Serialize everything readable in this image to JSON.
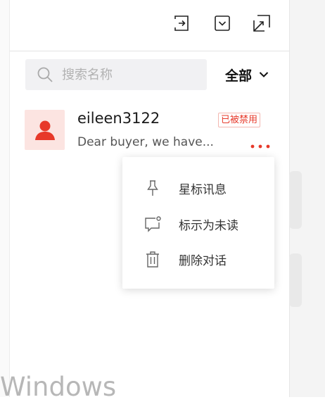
{
  "toolbar": {
    "buttons": [
      {
        "icon": "exit-icon"
      },
      {
        "icon": "chevron-down-box-icon"
      },
      {
        "icon": "resize-arrow-icon"
      }
    ]
  },
  "search": {
    "placeholder": "搜索名称",
    "value": ""
  },
  "filter": {
    "label": "全部",
    "icon": "chevron-down-icon"
  },
  "conversation": {
    "name": "eileen3122",
    "badge": "已被禁用",
    "preview": "Dear buyer, we have...",
    "avatar_icon": "user-icon",
    "more_icon": "more-dots-icon"
  },
  "context_menu": {
    "items": [
      {
        "label": "星标讯息",
        "icon": "pin-icon"
      },
      {
        "label": "标示为未读",
        "icon": "unread-icon"
      },
      {
        "label": "删除对话",
        "icon": "trash-icon"
      }
    ]
  },
  "watermark": "Windows",
  "colors": {
    "accent": "#e7392a",
    "avatar_bg": "#fce4e1",
    "search_bg": "#f1f1f3"
  }
}
